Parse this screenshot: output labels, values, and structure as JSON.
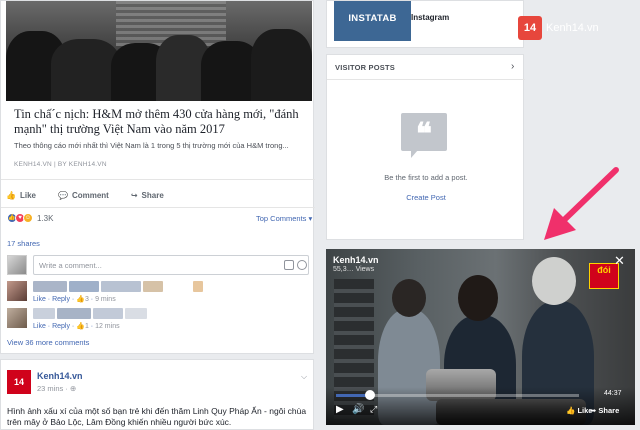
{
  "post1": {
    "headline": "Tin chấ´c nịch: H&M mở thêm 430 cửa hàng mới, \"đánh mạnh\" thị trường Việt Nam vào năm 2017",
    "subline": "Theo thông cáo mới nhất thì Việt Nam là 1 trong 5 thị trường mới của H&M trong...",
    "source_domain": "KENH14.VN",
    "source_by": "BY KENH14.VN",
    "actions": {
      "like": "Like",
      "comment": "Comment",
      "share": "Share"
    },
    "reaction_count": "1.3K",
    "top_comments": "Top Comments",
    "shares": "17 shares",
    "comment_placeholder": "Write a comment...",
    "comments": [
      {
        "like": "Like",
        "reply": "Reply",
        "reactions": "3",
        "time": "9 mins"
      },
      {
        "like": "Like",
        "reply": "Reply",
        "reactions": "1",
        "time": "12 mins"
      }
    ],
    "view_more": "View 36 more comments"
  },
  "post2": {
    "page_name": "Kenh14.vn",
    "time": "23 mins",
    "text": "Hình ảnh xấu xí của một số bạn trẻ khi đến thăm Linh Quy Pháp Ấn - ngôi chùa trên mây ở Bảo Lộc, Lâm Đồng khiến nhiều người bức xúc."
  },
  "sidebar": {
    "instatab_logo": "INSTATAB",
    "instatab_name": "Instagram",
    "visitor_posts_title": "VISITOR POSTS",
    "visitor_empty": "Be the first to add a post.",
    "create_post": "Create Post"
  },
  "brand": {
    "logo_text": "14",
    "name": "Kenh14.vn"
  },
  "video": {
    "channel": "Kenh14.vn",
    "views": "55,3… Views",
    "badge": "đói",
    "time_left": "44:37",
    "progress": 0.14,
    "like": "Like",
    "share": "Share"
  },
  "colors": {
    "accent": "#4267b2",
    "brand_red": "#e7463c",
    "arrow": "#f0306b"
  },
  "icons": [
    "close-icon",
    "play-icon",
    "volume-icon",
    "expand-icon",
    "like-icon",
    "share-icon",
    "camera-icon",
    "sticker-icon",
    "chevron-right-icon",
    "quote-icon"
  ]
}
